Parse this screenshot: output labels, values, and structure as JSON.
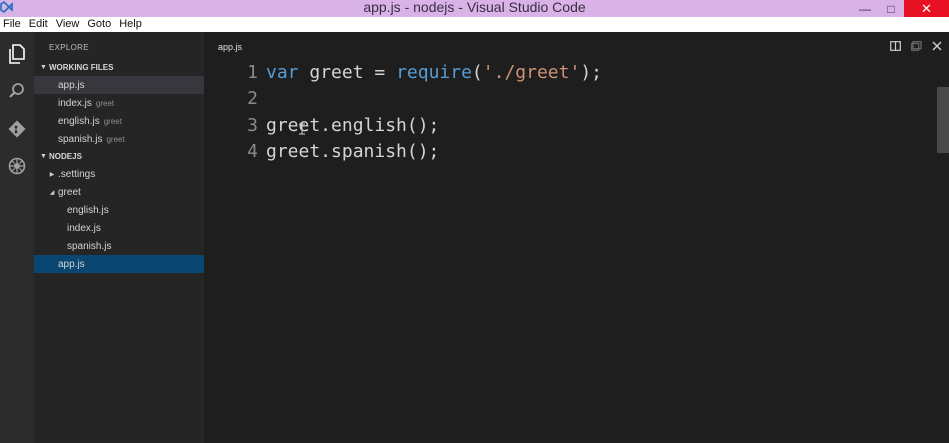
{
  "window": {
    "title": "app.js - nodejs - Visual Studio Code",
    "minimize_glyph": "—",
    "maximize_glyph": "□",
    "close_glyph": "✕"
  },
  "menu": [
    "File",
    "Edit",
    "View",
    "Goto",
    "Help"
  ],
  "activity_bar": {
    "icons": [
      "explorer-icon",
      "search-icon",
      "git-icon",
      "debug-icon"
    ]
  },
  "sidebar": {
    "title": "EXPLORE",
    "working_files": {
      "header": "WORKING FILES",
      "items": [
        {
          "label": "app.js",
          "hint": ""
        },
        {
          "label": "index.js",
          "hint": "greet"
        },
        {
          "label": "english.js",
          "hint": "greet"
        },
        {
          "label": "spanish.js",
          "hint": "greet"
        }
      ]
    },
    "project": {
      "header": "NODEJS",
      "items": [
        {
          "label": ".settings"
        },
        {
          "label": "greet"
        },
        {
          "label": "english.js"
        },
        {
          "label": "index.js"
        },
        {
          "label": "spanish.js"
        },
        {
          "label": "app.js"
        }
      ]
    }
  },
  "editor": {
    "tab": "app.js",
    "lines": [
      {
        "num": "1",
        "tokens": [
          {
            "text": "var",
            "kind": "kw"
          },
          {
            "text": " greet = ",
            "kind": "plain"
          },
          {
            "text": "require",
            "kind": "kw"
          },
          {
            "text": "(",
            "kind": "plain"
          },
          {
            "text": "'./greet'",
            "kind": "str"
          },
          {
            "text": ");",
            "kind": "plain"
          }
        ]
      },
      {
        "num": "2",
        "tokens": []
      },
      {
        "num": "3",
        "tokens": [
          {
            "text": "greet.english();",
            "kind": "plain"
          }
        ]
      },
      {
        "num": "4",
        "tokens": [
          {
            "text": "greet.spanish();",
            "kind": "plain"
          }
        ]
      }
    ]
  },
  "colors": {
    "titlebar": "#d9b3e8",
    "keyword": "#569cd6",
    "string": "#ce9178",
    "selection": "#094771",
    "close_button": "#e81123"
  }
}
